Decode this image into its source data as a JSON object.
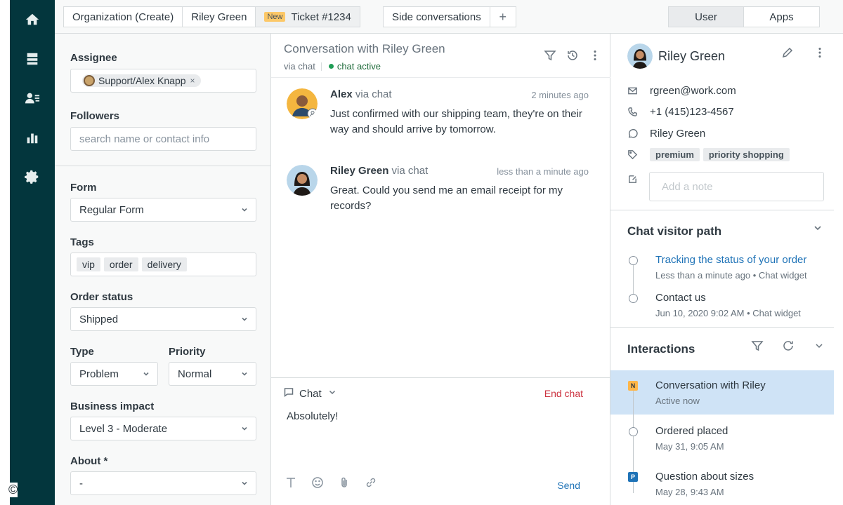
{
  "tabs": [
    {
      "label": "Organization (Create)"
    },
    {
      "label": "Riley Green"
    },
    {
      "badge": "New",
      "label": "Ticket #1234"
    }
  ],
  "side_tab": {
    "label": "Side conversations",
    "plus": "+"
  },
  "segmented": {
    "user": "User",
    "apps": "Apps"
  },
  "left": {
    "assignee_label": "Assignee",
    "assignee_value": "Support/Alex Knapp",
    "assignee_remove": "×",
    "followers_label": "Followers",
    "followers_placeholder": "search name or contact info",
    "form_label": "Form",
    "form_value": "Regular Form",
    "tags_label": "Tags",
    "tags": [
      "vip",
      "order",
      "delivery"
    ],
    "order_status_label": "Order status",
    "order_status_value": "Shipped",
    "type_label": "Type",
    "type_value": "Problem",
    "priority_label": "Priority",
    "priority_value": "Normal",
    "business_impact_label": "Business impact",
    "business_impact_value": "Level 3 - Moderate",
    "about_label": "About *",
    "about_value": "-"
  },
  "conversation": {
    "title": "Conversation with Riley Green",
    "via": "via chat",
    "status": "chat active",
    "messages": [
      {
        "name": "Alex",
        "via": "via chat",
        "time": "2 minutes ago",
        "text": "Just confirmed with our shipping team, they're on their way and should arrive by tomorrow."
      },
      {
        "name": "Riley Green",
        "via": "via chat",
        "time": "less than a minute ago",
        "text": "Great. Could you send me an email receipt for my records?"
      }
    ],
    "channel": "Chat",
    "end_chat": "End chat",
    "composer_text": "Absolutely!",
    "send": "Send"
  },
  "user": {
    "name": "Riley Green",
    "email": "rgreen@work.com",
    "phone": "+1 (415)123-4567",
    "whatsapp": "Riley Green",
    "tags": [
      "premium",
      "priority shopping"
    ],
    "note_placeholder": "Add a note"
  },
  "visitor_path": {
    "title": "Chat visitor path",
    "items": [
      {
        "title": "Tracking the status of your order",
        "sub": "Less than a minute ago • Chat widget"
      },
      {
        "title": "Contact us",
        "sub": "Jun 10, 2020 9:02 AM • Chat widget"
      }
    ]
  },
  "interactions": {
    "title": "Interactions",
    "items": [
      {
        "badge": "N",
        "title": "Conversation with Riley",
        "sub": "Active now"
      },
      {
        "title": "Ordered placed",
        "sub": "May 31, 9:05 AM"
      },
      {
        "badge": "P",
        "title": "Question about sizes",
        "sub": "May 28, 9:43 AM"
      }
    ]
  },
  "footer": {
    "copyright": "©"
  },
  "colors": {
    "nav": "#03363d",
    "link": "#1f73b7",
    "end_chat": "#cc3340",
    "active_dot": "#1f9d55",
    "highlight": "#cfe3f6"
  }
}
